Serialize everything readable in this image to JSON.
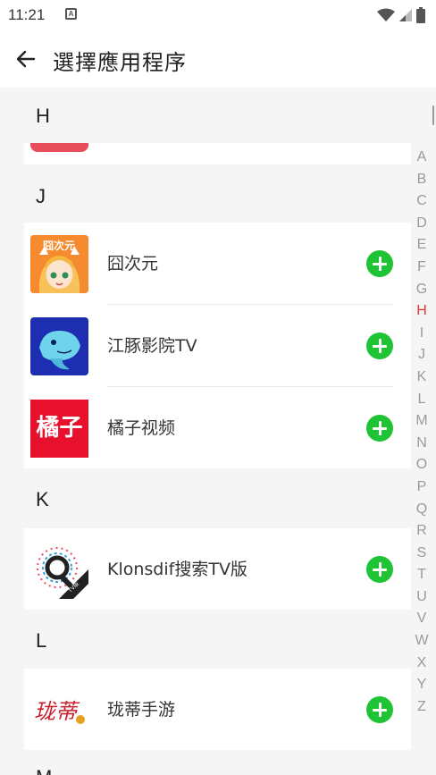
{
  "status_bar": {
    "time": "11:21",
    "notification_icon": "A"
  },
  "app_bar": {
    "title": "選擇應用程序"
  },
  "sections": [
    {
      "letter": "H"
    },
    {
      "letter": "J",
      "apps": [
        {
          "name": "囧次元",
          "icon_text": "囧次元"
        },
        {
          "name": "江豚影院TV"
        },
        {
          "name": "橘子视频",
          "icon_text": "橘子"
        }
      ]
    },
    {
      "letter": "K",
      "apps": [
        {
          "name": "Klonsdif搜索TV版",
          "icon_text": "TV版"
        }
      ]
    },
    {
      "letter": "L",
      "apps": [
        {
          "name": "珑蒂手游",
          "icon_text": "珑蒂"
        }
      ]
    },
    {
      "letter": "M"
    }
  ],
  "alphabet": [
    "A",
    "B",
    "C",
    "D",
    "E",
    "F",
    "G",
    "H",
    "I",
    "J",
    "K",
    "L",
    "M",
    "N",
    "O",
    "P",
    "Q",
    "R",
    "S",
    "T",
    "U",
    "V",
    "W",
    "X",
    "Y",
    "Z"
  ],
  "active_letter": "H",
  "colors": {
    "add_button": "#1fc435",
    "active_letter": "#e53935",
    "partial_icon_h": "#e84d5c"
  }
}
